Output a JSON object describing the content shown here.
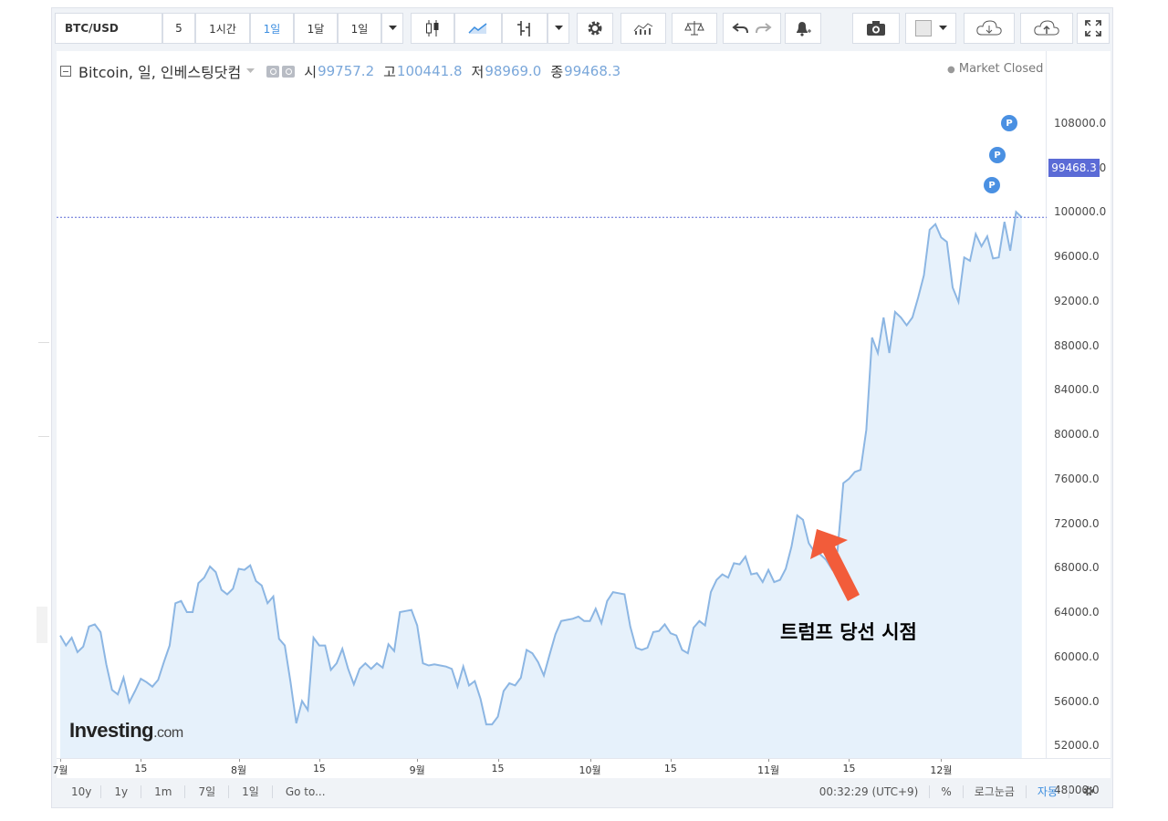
{
  "toolbar": {
    "symbol": "BTC/USD",
    "intervals": [
      "5",
      "1시간",
      "1일",
      "1달",
      "1일"
    ],
    "active_interval": "1일"
  },
  "legend": {
    "title": "Bitcoin, 일, 인베스팅닷컴",
    "open_label": "시",
    "open": "99757.2",
    "high_label": "고",
    "high": "100441.8",
    "low_label": "저",
    "low": "98969.0",
    "close_label": "종",
    "close": "99468.3"
  },
  "status": "Market Closed",
  "logo": {
    "main": "Investing",
    "suffix": ".com"
  },
  "annotation": "트럼프 당선 시점",
  "current_price_tag": "99468.3",
  "bottom_bar": {
    "ranges": [
      "10y",
      "1y",
      "1m",
      "7일",
      "1일"
    ],
    "goto": "Go to...",
    "time": "00:32:29 (UTC+9)",
    "percent": "%",
    "log": "로그눈금",
    "auto": "자동"
  },
  "colors": {
    "line": "#8cb6e3",
    "fill": "#e6f1fb",
    "accent": "#3c8ee0",
    "arrow": "#f25c3a",
    "price_tag": "#5b6bd6"
  },
  "chart_data": {
    "type": "area",
    "title": "Bitcoin, 일, 인베스팅닷컴",
    "ylabel": "",
    "ylim": [
      45000,
      110000
    ],
    "yticks": [
      "108000.0",
      "104000.0",
      "100000.0",
      "96000.0",
      "92000.0",
      "88000.0",
      "84000.0",
      "80000.0",
      "76000.0",
      "72000.0",
      "68000.0",
      "64000.0",
      "60000.0",
      "56000.0",
      "52000.0",
      "48000.0"
    ],
    "xticks": [
      {
        "label": "7월",
        "day": 1
      },
      {
        "label": "15",
        "day": 15
      },
      {
        "label": "8월",
        "day": 32
      },
      {
        "label": "15",
        "day": 46
      },
      {
        "label": "9월",
        "day": 63
      },
      {
        "label": "15",
        "day": 77
      },
      {
        "label": "10월",
        "day": 93
      },
      {
        "label": "15",
        "day": 107
      },
      {
        "label": "11월",
        "day": 124
      },
      {
        "label": "15",
        "day": 138
      },
      {
        "label": "12월",
        "day": 154
      }
    ],
    "x_start": "2024-06-30",
    "y": [
      61900,
      61000,
      61700,
      60400,
      60900,
      62700,
      62900,
      62200,
      59300,
      57000,
      56600,
      58100,
      55900,
      56900,
      58000,
      57700,
      57300,
      57900,
      59500,
      61000,
      64800,
      65000,
      64000,
      64000,
      66600,
      67100,
      68100,
      67600,
      66000,
      65600,
      66100,
      67900,
      67800,
      68200,
      66800,
      66400,
      64800,
      65400,
      61600,
      61000,
      57700,
      54000,
      56000,
      55200,
      61700,
      61000,
      61000,
      58800,
      59400,
      60700,
      58900,
      57500,
      58900,
      59400,
      58900,
      59400,
      59000,
      61100,
      60500,
      64000,
      64100,
      64200,
      62800,
      59400,
      59200,
      59300,
      59200,
      59100,
      58900,
      57300,
      59100,
      57400,
      57800,
      56200,
      53900,
      53900,
      54600,
      56900,
      57600,
      57400,
      58100,
      60600,
      60300,
      59500,
      58300,
      60200,
      62000,
      63200,
      63300,
      63400,
      63600,
      63200,
      63200,
      64300,
      63000,
      65000,
      65800,
      65700,
      65600,
      62700,
      60800,
      60600,
      60800,
      62200,
      62300,
      62900,
      62100,
      61900,
      60600,
      60300,
      62600,
      63200,
      62800,
      65800,
      66900,
      67400,
      67100,
      68400,
      68300,
      69000,
      67400,
      67500,
      66700,
      67800,
      66700,
      66900,
      67900,
      69900,
      72700,
      72300,
      70200,
      69400,
      69200,
      68700,
      67900,
      69500,
      75600,
      76000,
      76600,
      76800,
      80400,
      88700,
      87300,
      90500,
      87300,
      91000,
      90500,
      89800,
      90500,
      92300,
      94300,
      98400,
      98900,
      97700,
      97300,
      93200,
      91900,
      95900,
      95600,
      98000,
      96900,
      97800,
      95800,
      95900,
      99100,
      96500,
      100000,
      99500
    ]
  },
  "markers": [
    "P",
    "P",
    "P"
  ]
}
